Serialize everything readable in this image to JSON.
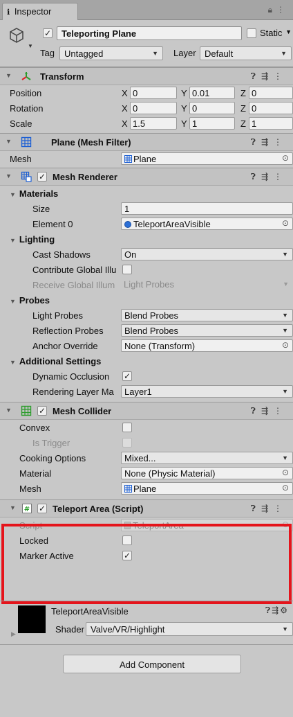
{
  "tab": {
    "label": "Inspector",
    "icon": "info-icon"
  },
  "gameobject": {
    "active": true,
    "name": "Teleporting Plane",
    "static_label": "Static",
    "tag_label": "Tag",
    "tag_value": "Untagged",
    "layer_label": "Layer",
    "layer_value": "Default"
  },
  "transform": {
    "title": "Transform",
    "position_label": "Position",
    "position": {
      "x": "0",
      "y": "0.01",
      "z": "0"
    },
    "rotation_label": "Rotation",
    "rotation": {
      "x": "0",
      "y": "0",
      "z": "0"
    },
    "scale_label": "Scale",
    "scale": {
      "x": "1.5",
      "y": "1",
      "z": "1"
    },
    "axis": {
      "x": "X",
      "y": "Y",
      "z": "Z"
    }
  },
  "mesh_filter": {
    "title": "Plane (Mesh Filter)",
    "mesh_label": "Mesh",
    "mesh_value": "Plane"
  },
  "mesh_renderer": {
    "title": "Mesh Renderer",
    "materials_label": "Materials",
    "size_label": "Size",
    "size_value": "1",
    "element0_label": "Element 0",
    "element0_value": "TeleportAreaVisible",
    "lighting_label": "Lighting",
    "cast_shadows_label": "Cast Shadows",
    "cast_shadows_value": "On",
    "contribute_gi_label": "Contribute Global Illu",
    "receive_gi_label": "Receive Global Illum",
    "receive_gi_value": "Light Probes",
    "probes_label": "Probes",
    "light_probes_label": "Light Probes",
    "light_probes_value": "Blend Probes",
    "reflection_probes_label": "Reflection Probes",
    "reflection_probes_value": "Blend Probes",
    "anchor_override_label": "Anchor Override",
    "anchor_override_value": "None (Transform)",
    "additional_label": "Additional Settings",
    "dynamic_occlusion_label": "Dynamic Occlusion",
    "rendering_layer_label": "Rendering Layer Ma",
    "rendering_layer_value": "Layer1"
  },
  "mesh_collider": {
    "title": "Mesh Collider",
    "convex_label": "Convex",
    "is_trigger_label": "Is Trigger",
    "cooking_label": "Cooking Options",
    "cooking_value": "Mixed...",
    "material_label": "Material",
    "material_value": "None (Physic Material)",
    "mesh_label": "Mesh",
    "mesh_value": "Plane"
  },
  "teleport_area": {
    "title": "Teleport Area (Script)",
    "script_label": "Script",
    "script_value": "TeleportArea",
    "locked_label": "Locked",
    "marker_active_label": "Marker Active"
  },
  "material": {
    "name": "TeleportAreaVisible",
    "shader_label": "Shader",
    "shader_value": "Valve/VR/Highlight"
  },
  "add_component_label": "Add Component",
  "colors": {
    "highlight": "#e5141b",
    "background": "#c8c8c8",
    "material_swatch": "#000000"
  }
}
